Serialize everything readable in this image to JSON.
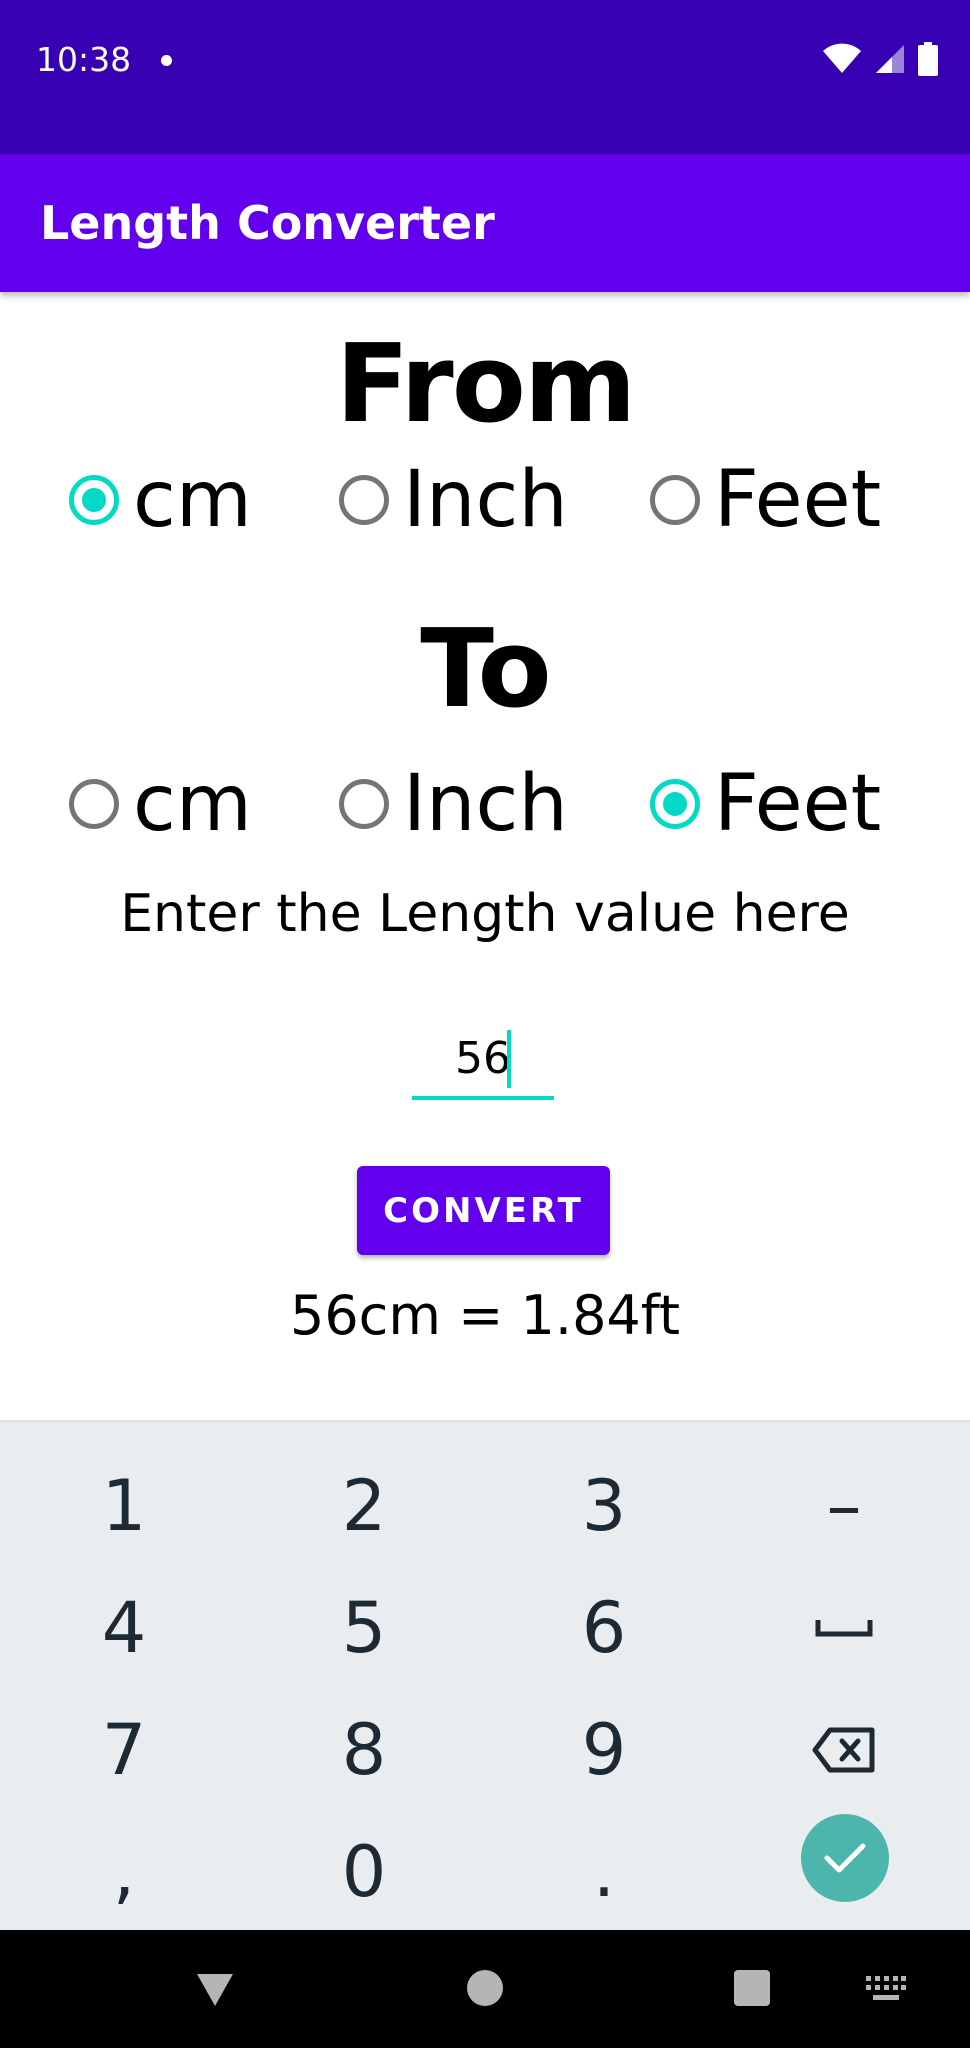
{
  "status_bar": {
    "time": "10:38"
  },
  "app_bar": {
    "title": "Length Converter"
  },
  "from": {
    "heading": "From",
    "options": [
      {
        "label": "cm",
        "checked": true
      },
      {
        "label": "Inch",
        "checked": false
      },
      {
        "label": "Feet",
        "checked": false
      }
    ]
  },
  "to": {
    "heading": "To",
    "options": [
      {
        "label": "cm",
        "checked": false
      },
      {
        "label": "Inch",
        "checked": false
      },
      {
        "label": "Feet",
        "checked": true
      }
    ]
  },
  "prompt": "Enter the Length value here",
  "input": {
    "value": "56"
  },
  "convert_button": {
    "label": "CONVERT"
  },
  "result": "56cm = 1.84ft",
  "keyboard": {
    "keys": [
      "1",
      "2",
      "3",
      "–",
      "4",
      "5",
      "6",
      "␣",
      "7",
      "8",
      "9",
      "⌫",
      ",",
      "0",
      ".",
      "✓"
    ]
  },
  "colors": {
    "status_bar": "#3700b3",
    "primary": "#6200ee",
    "accent": "#03dac5",
    "keyboard_bg": "#e9edf0",
    "done_key": "#4db6ac"
  },
  "icons": {
    "status": [
      "wifi-icon",
      "signal-icon",
      "battery-icon"
    ],
    "nav": [
      "back-icon",
      "home-icon",
      "recents-icon",
      "keyboard-switch-icon"
    ]
  }
}
